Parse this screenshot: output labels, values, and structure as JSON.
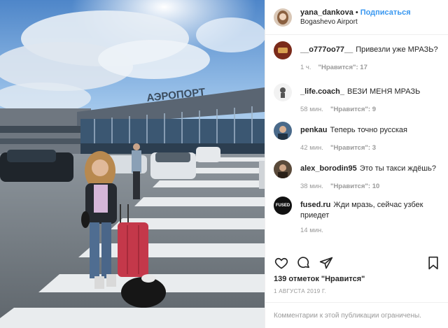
{
  "header": {
    "username": "yana_dankova",
    "separator": "•",
    "follow_label": "Подписаться",
    "location": "Bogashevo Airport"
  },
  "photo": {
    "sign_text": "АЭРОПОРТ"
  },
  "comments": [
    {
      "username": "__o777oo77__",
      "text": "Привезли уже МРАЗЬ?",
      "time": "1 ч.",
      "likes": "\"Нравится\": 17",
      "avatar_color": "#7a2a1a"
    },
    {
      "username": "_life.coach_",
      "text": "ВЕЗИ МЕНЯ МРАЗЬ",
      "time": "58 мин.",
      "likes": "\"Нравится\": 9",
      "avatar_color": "#f2f2f2"
    },
    {
      "username": "penkau",
      "text": "Теперь точно русская",
      "time": "42 мин.",
      "likes": "\"Нравится\": 3",
      "avatar_color": "#4a6a8a"
    },
    {
      "username": "alex_borodin95",
      "text": "Это ты такси ждёшь?",
      "time": "38 мин.",
      "likes": "\"Нравится\": 10",
      "avatar_color": "#5a4a3a"
    },
    {
      "username": "fused.ru",
      "text": "Жди мразь, сейчас узбек приедет",
      "time": "14 мин.",
      "likes": "",
      "avatar_color": "#111111",
      "avatar_text": "FUSED"
    }
  ],
  "actions": {
    "like_icon": "heart-icon",
    "comment_icon": "comment-icon",
    "share_icon": "share-icon",
    "save_icon": "bookmark-icon"
  },
  "likes_text": "139 отметок \"Нравится\"",
  "date_text": "1 АВГУСТА 2019 Г.",
  "footer_text": "Комментарии к этой публикации ограничены."
}
